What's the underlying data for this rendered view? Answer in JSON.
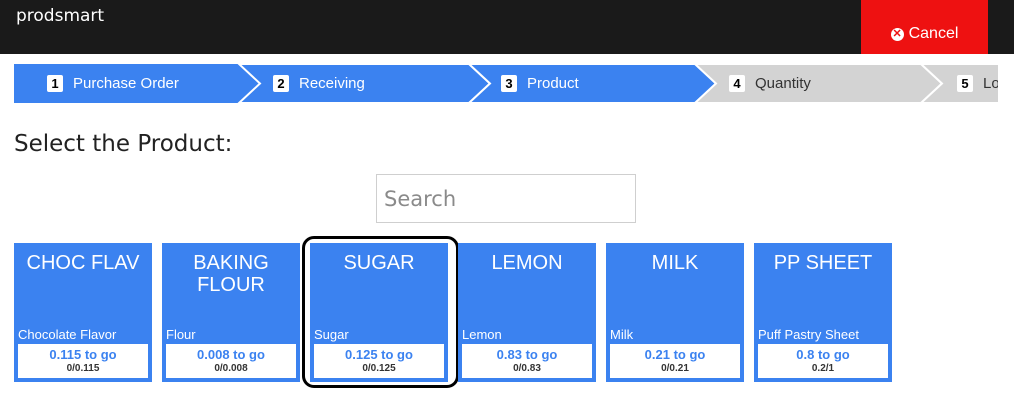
{
  "app": {
    "brand": "prodsmart"
  },
  "header": {
    "cancel_label": "Cancel",
    "cancel_icon": "x-circle-icon"
  },
  "steps": [
    {
      "num": "1",
      "label": "Purchase Order",
      "state": "done"
    },
    {
      "num": "2",
      "label": "Receiving",
      "state": "done"
    },
    {
      "num": "3",
      "label": "Product",
      "state": "current"
    },
    {
      "num": "4",
      "label": "Quantity",
      "state": "pending"
    },
    {
      "num": "5",
      "label": "Lo",
      "state": "pending"
    }
  ],
  "main": {
    "heading": "Select the Product:",
    "search_placeholder": "Search"
  },
  "products": [
    {
      "code": "CHOC FLAV",
      "name": "Chocolate Flavor",
      "togo": "0.115 to go",
      "ratio": "0/0.115"
    },
    {
      "code": "BAKING FLOUR",
      "name": "Flour",
      "togo": "0.008 to go",
      "ratio": "0/0.008"
    },
    {
      "code": "SUGAR",
      "name": "Sugar",
      "togo": "0.125 to go",
      "ratio": "0/0.125",
      "selected": true
    },
    {
      "code": "LEMON",
      "name": "Lemon",
      "togo": "0.83 to go",
      "ratio": "0/0.83"
    },
    {
      "code": "MILK",
      "name": "Milk",
      "togo": "0.21 to go",
      "ratio": "0/0.21"
    },
    {
      "code": "PP SHEET",
      "name": "Puff Pastry Sheet",
      "togo": "0.8 to go",
      "ratio": "0.2/1"
    }
  ],
  "colors": {
    "accent": "#3b82f0",
    "cancel": "#ee1111",
    "pending_step": "#d3d3d3",
    "topbar": "#1a1a1a"
  }
}
